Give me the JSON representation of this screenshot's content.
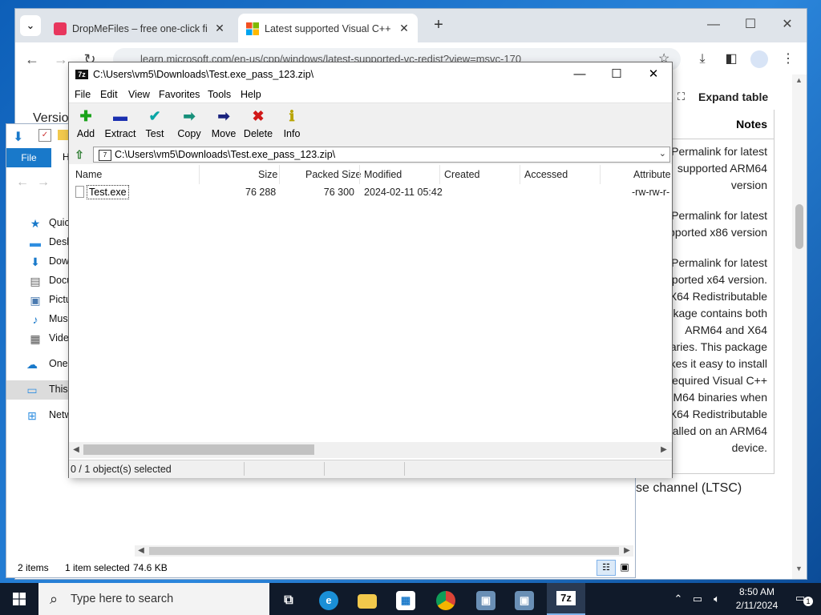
{
  "browser": {
    "tabs": [
      {
        "title": "DropMeFiles – free one-click fil",
        "favicon_color": "#e8365d"
      },
      {
        "title": "Latest supported Visual C++ Re",
        "favicon_color": "#f25022"
      }
    ],
    "url": "learn.microsoft.com/en-us/cpp/windows/latest-supported-vc-redist?view=msvc-170",
    "page": {
      "version_fragment": "Versio",
      "expand_table": "Expand table",
      "notes_header": "Notes",
      "notes_lines": [
        "Permalink for latest",
        "supported ARM64",
        "version",
        "Permalink for latest",
        "pported x86 version",
        "Permalink for latest",
        "pported x64 version.",
        "X64 Redistributable",
        "kage contains both",
        "ARM64 and X64",
        "naries. This package",
        "kes it easy to install",
        "equired Visual C++",
        "M64 binaries when",
        "X64 Redistributable",
        "alled on an ARM64",
        "device."
      ],
      "ltsc_text": "se channel (LTSC)"
    }
  },
  "explorer": {
    "file_tab": "File",
    "ribbon_h": "H",
    "sidebar": [
      {
        "label": "Quick",
        "icon": "star-icon"
      },
      {
        "label": "Desk",
        "icon": "desktop-icon"
      },
      {
        "label": "Dow",
        "icon": "download-icon"
      },
      {
        "label": "Docu",
        "icon": "document-icon"
      },
      {
        "label": "Pictu",
        "icon": "picture-icon"
      },
      {
        "label": "Musi",
        "icon": "music-icon"
      },
      {
        "label": "Vide",
        "icon": "video-icon"
      },
      {
        "label": "OneDr",
        "icon": "cloud-icon"
      },
      {
        "label": "This P",
        "icon": "pc-icon"
      },
      {
        "label": "Netwo",
        "icon": "network-icon"
      }
    ],
    "status": {
      "items": "2 items",
      "selected": "1 item selected",
      "size": "74.6 KB"
    }
  },
  "sevenzip": {
    "title": "C:\\Users\\vm5\\Downloads\\Test.exe_pass_123.zip\\",
    "logo": "7z",
    "menu": [
      "File",
      "Edit",
      "View",
      "Favorites",
      "Tools",
      "Help"
    ],
    "toolbar": [
      {
        "label": "Add",
        "icon": "add-icon",
        "glyph": "✚",
        "color": "#1aa31a"
      },
      {
        "label": "Extract",
        "icon": "extract-icon",
        "glyph": "▬",
        "color": "#1a2fb0"
      },
      {
        "label": "Test",
        "icon": "test-icon",
        "glyph": "✔",
        "color": "#0aa6a6"
      },
      {
        "label": "Copy",
        "icon": "copy-icon",
        "glyph": "➡",
        "color": "#17907a"
      },
      {
        "label": "Move",
        "icon": "move-icon",
        "glyph": "➡",
        "color": "#1a237e"
      },
      {
        "label": "Delete",
        "icon": "delete-icon",
        "glyph": "✖",
        "color": "#d01818"
      },
      {
        "label": "Info",
        "icon": "info-icon",
        "glyph": "ℹ",
        "color": "#b8a400"
      }
    ],
    "path": "C:\\Users\\vm5\\Downloads\\Test.exe_pass_123.zip\\",
    "columns": [
      "Name",
      "Size",
      "Packed Size",
      "Modified",
      "Created",
      "Accessed",
      "Attribute"
    ],
    "rows": [
      {
        "name": "Test.exe",
        "size": "76 288",
        "packed": "76 300",
        "modified": "2024-02-11 05:42",
        "created": "",
        "accessed": "",
        "attributes": "-rw-rw-r-"
      }
    ],
    "status": "0 / 1 object(s) selected"
  },
  "taskbar": {
    "search_placeholder": "Type here to search",
    "time": "8:50 AM",
    "date": "2/11/2024",
    "notification_count": "1",
    "seven_zip_label": "7z"
  }
}
